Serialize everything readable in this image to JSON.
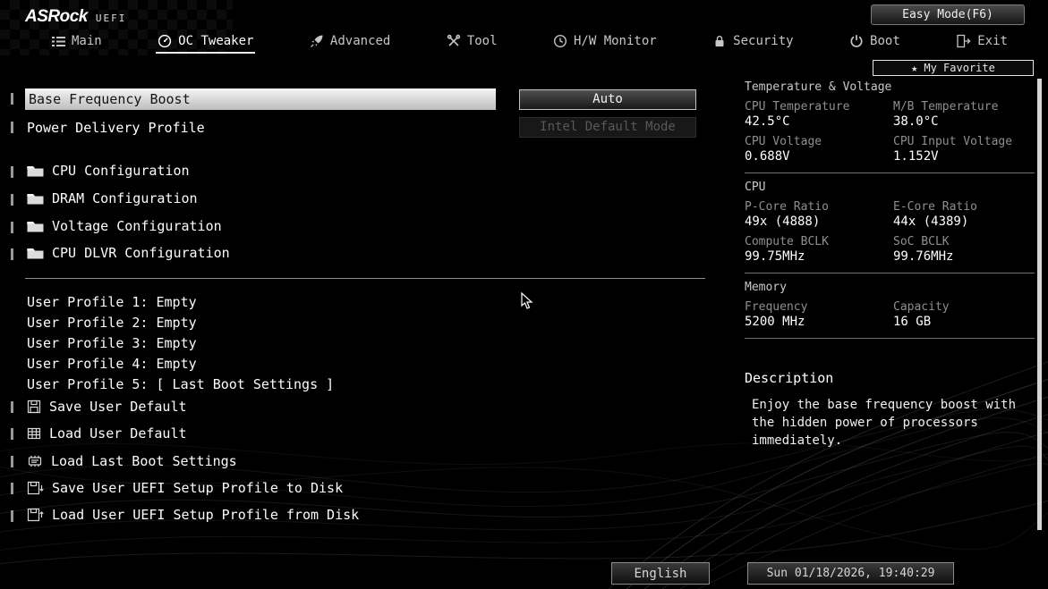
{
  "header": {
    "brand": "ASRock",
    "brand_sub": "UEFI",
    "easy_mode": "Easy Mode(F6)"
  },
  "nav": {
    "tabs": [
      {
        "label": "Main"
      },
      {
        "label": "OC Tweaker"
      },
      {
        "label": "Advanced"
      },
      {
        "label": "Tool"
      },
      {
        "label": "H/W Monitor"
      },
      {
        "label": "Security"
      },
      {
        "label": "Boot"
      },
      {
        "label": "Exit"
      }
    ],
    "active_tab": "OC Tweaker",
    "star": "★",
    "my_favorite": "My Favorite"
  },
  "main": {
    "selected_setting": {
      "label": "Base Frequency Boost",
      "value": "Auto"
    },
    "power_delivery": {
      "label": "Power Delivery Profile",
      "value": "Intel Default Mode",
      "disabled": true
    },
    "folders": [
      "CPU Configuration",
      "DRAM Configuration",
      "Voltage Configuration",
      "CPU DLVR Configuration"
    ],
    "profiles": [
      "User Profile 1: Empty",
      "User Profile 2: Empty",
      "User Profile 3: Empty",
      "User Profile 4: Empty",
      "User Profile 5: [ Last Boot Settings ]"
    ],
    "actions": [
      "Save User Default",
      "Load User Default",
      "Load Last Boot Settings",
      "Save User UEFI Setup Profile to Disk",
      "Load User UEFI Setup Profile from Disk"
    ]
  },
  "sidebar": {
    "temp_section": {
      "title": "Temperature & Voltage",
      "items": [
        {
          "label": "CPU Temperature",
          "value": "42.5°C"
        },
        {
          "label": "M/B Temperature",
          "value": "38.0°C"
        },
        {
          "label": "CPU Voltage",
          "value": "0.688V"
        },
        {
          "label": "CPU Input Voltage",
          "value": "1.152V"
        }
      ]
    },
    "cpu_section": {
      "title": "CPU",
      "items": [
        {
          "label": "P-Core Ratio",
          "value": "49x (4888)"
        },
        {
          "label": "E-Core Ratio",
          "value": "44x (4389)"
        },
        {
          "label": "Compute BCLK",
          "value": "99.75MHz"
        },
        {
          "label": "SoC BCLK",
          "value": "99.76MHz"
        }
      ]
    },
    "memory_section": {
      "title": "Memory",
      "items": [
        {
          "label": "Frequency",
          "value": "5200 MHz"
        },
        {
          "label": "Capacity",
          "value": "16 GB"
        }
      ]
    },
    "description": {
      "title": "Description",
      "text": "Enjoy the base frequency boost with the hidden power of processors immediately."
    }
  },
  "footer": {
    "language": "English",
    "datetime": "Sun 01/18/2026, 19:40:29"
  },
  "colors": {
    "background": "#000000",
    "highlight_row_bg": "#d9d9d9",
    "text": "#ffffff",
    "muted_label": "#8f8f8f",
    "disabled_text": "#585858"
  }
}
